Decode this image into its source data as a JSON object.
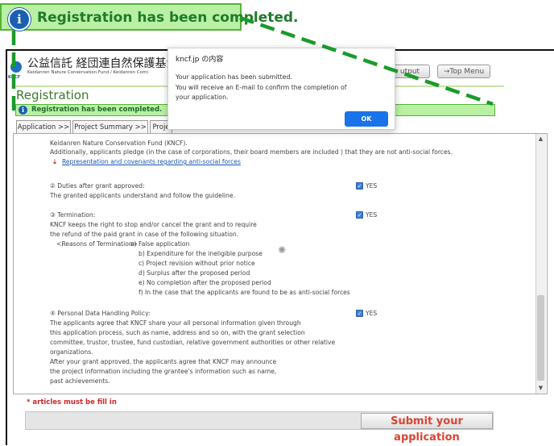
{
  "callout": {
    "text": "Registration has been completed."
  },
  "header": {
    "org_jp": "公益信託 経団連自然保護基金 /",
    "org_en": "Keidanren Nature Conservation Fund / Keidanren Comi",
    "logo_label": "KNCF",
    "output_button": "utput",
    "top_menu_button": "→Top Menu"
  },
  "page_title": "Registration",
  "status_bar": {
    "text": "Registration has been completed."
  },
  "tabs": [
    {
      "label": "Application >>"
    },
    {
      "label": "Project Summary >>"
    },
    {
      "label": "Proje"
    }
  ],
  "content": {
    "intro_lines": [
      "Keidanren Nature Conservation Fund (KNCF).",
      "Additionally, applicants pledge (in the case of corporations, their board members are included ) that they are not anti-social forces."
    ],
    "covenant_link": "Representation and covenants regarding anti-social forces",
    "sections": [
      {
        "heading": "② Duties after grant approved:",
        "body": [
          "The granted applicants understand and follow the guideline."
        ],
        "check_label": "YES"
      },
      {
        "heading": "③ Termination:",
        "body": [
          "KNCF keeps the right to stop and/or cancel the grant and to require",
          "the refund of the paid grant in case of the following situation."
        ],
        "check_label": "YES",
        "reasons_label": "<Reasons of Termination>",
        "reasons": [
          "a) False application",
          "b) Expenditure for the ineligible purpose",
          "c) Project revision without prior notice",
          "d) Surplus after the proposed period",
          "e) No completion after the proposed period",
          "f) In the case that the applicants are found to be as anti-social forces"
        ]
      },
      {
        "heading": "④ Personal Data Handling Policy:",
        "body": [
          "The applicants agree that KNCF share your all personal information given through",
          "this application process, such as name, address and so on, with the grant selection",
          "committee, trustor, trustee, fund custodian, relative government authorities or other relative",
          "organizations.",
          "After your grant approved,  the applicants agree that KNCF may announce",
          "the project information including the grantee's information such as name,",
          "past achievements."
        ],
        "check_label": "YES"
      }
    ]
  },
  "required_note": "* articles must be fill in",
  "submit_button": "Submit your application",
  "dialog": {
    "title": "kncf.jp の内容",
    "message_lines": [
      "Your application has been submitted.",
      "You will receive an E-mail to confirm the completion of",
      "your application."
    ],
    "ok_label": "OK"
  },
  "colors": {
    "success_bg": "#b9f0a4",
    "success_border": "#55b338",
    "dialog_ok": "#1a73e8",
    "submit_text": "#d84433",
    "dashed_line": "#1a9b2a"
  }
}
